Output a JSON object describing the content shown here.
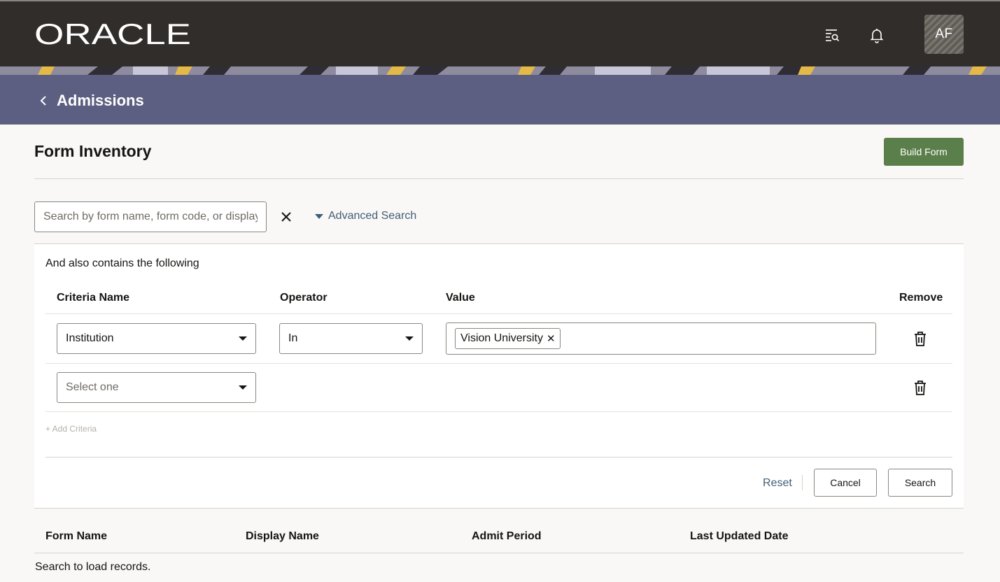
{
  "header": {
    "logo_text": "ORACLE",
    "icons": [
      "search-list-icon",
      "bell-icon"
    ],
    "avatar_initials": "AF"
  },
  "banner": {
    "title": "Admissions"
  },
  "page": {
    "title": "Form Inventory",
    "build_form_label": "Build Form"
  },
  "search": {
    "placeholder": "Search by form name, form code, or display name",
    "advanced_label": "Advanced Search"
  },
  "advanced": {
    "heading": "And also contains the following",
    "columns": {
      "criteria": "Criteria Name",
      "operator": "Operator",
      "value": "Value",
      "remove": "Remove"
    },
    "rows": [
      {
        "criteria": "Institution",
        "operator": "In",
        "value_chip": "Vision University"
      },
      {
        "criteria_placeholder": "Select one"
      }
    ],
    "add_criteria_label": "+ Add Criteria",
    "reset_label": "Reset",
    "cancel_label": "Cancel",
    "search_label": "Search"
  },
  "table": {
    "columns": [
      "Form Name",
      "Display Name",
      "Admit Period",
      "Last Updated Date"
    ],
    "empty_message": "Search to load records."
  },
  "colors": {
    "header_bg": "#312d2a",
    "banner_bg": "#5d5f82",
    "primary_button": "#5b7f4a",
    "link": "#3f5f78"
  }
}
